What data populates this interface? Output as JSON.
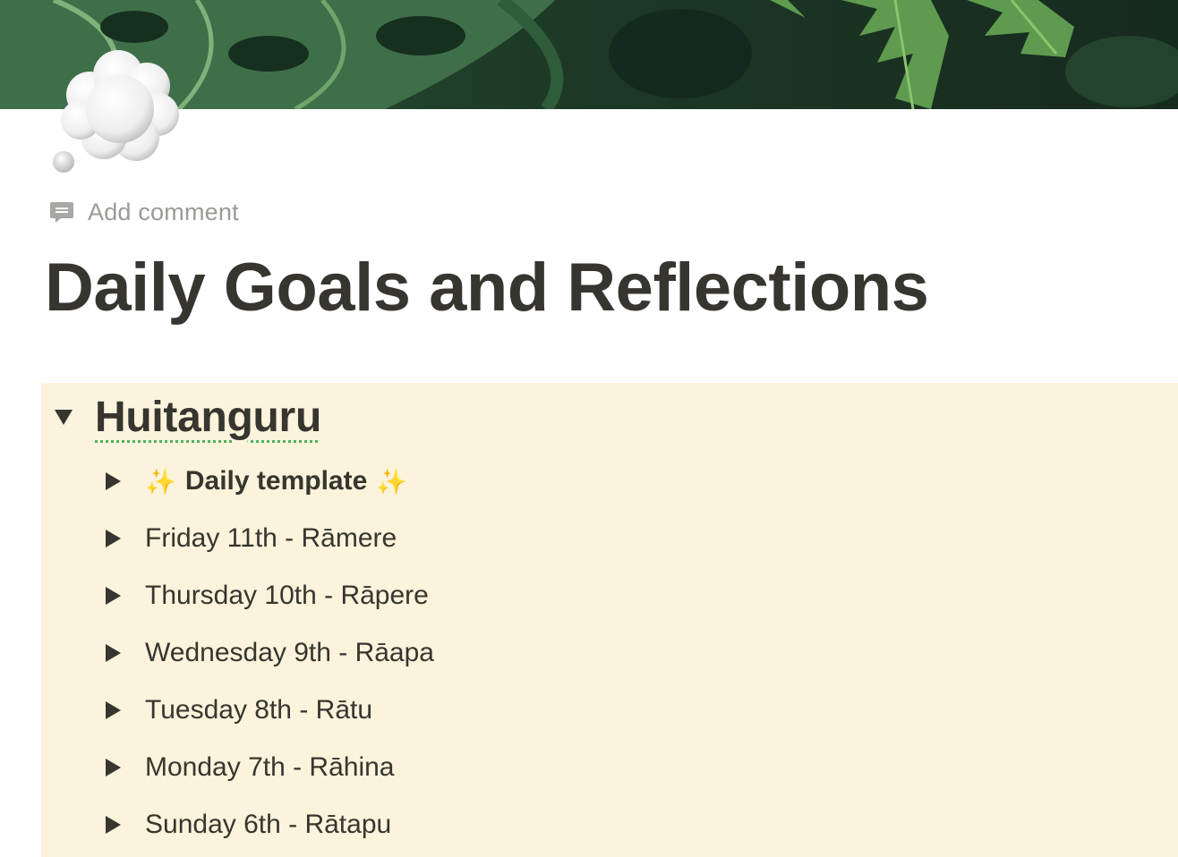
{
  "page": {
    "title": "Daily Goals and Reflections",
    "comment_label": "Add comment",
    "cover": "monstera-leaf-cover",
    "icon": "thought-balloon-icon"
  },
  "callout": {
    "background": "#fbf3db",
    "heading": "Huitanguru",
    "heading_expanded": true,
    "items": [
      {
        "label": "Daily template",
        "bold": true,
        "decoration": "sparkles-icon"
      },
      {
        "label": "Friday 11th - Rāmere"
      },
      {
        "label": "Thursday 10th - Rāpere"
      },
      {
        "label": "Wednesday 9th - Rāapa"
      },
      {
        "label": "Tuesday 8th - Rātu"
      },
      {
        "label": "Monday 7th - Rāhina"
      },
      {
        "label": "Sunday 6th - Rātapu"
      }
    ]
  },
  "colors": {
    "text": "#37352f",
    "muted": "#9b9a97",
    "spellcheck_underline": "#4cb35c",
    "sparkle": "#f2c94c"
  }
}
